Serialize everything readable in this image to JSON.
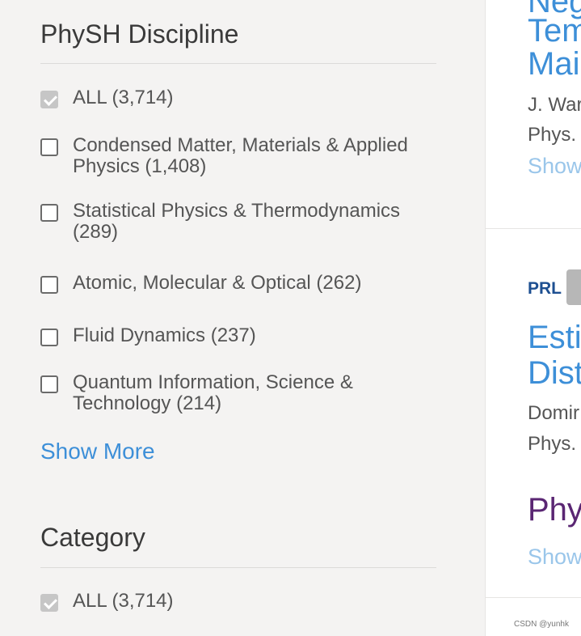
{
  "physh": {
    "title": "PhySH Discipline",
    "options": [
      {
        "label": "ALL (3,714)",
        "checked": true
      },
      {
        "label": "Condensed Matter, Materials & Applied Physics (1,408)",
        "checked": false
      },
      {
        "label": "Statistical Physics & Thermodynamics (289)",
        "checked": false
      },
      {
        "label": "Atomic, Molecular & Optical (262)",
        "checked": false
      },
      {
        "label": "Fluid Dynamics (237)",
        "checked": false
      },
      {
        "label": "Quantum Information, Science & Technology (214)",
        "checked": false
      }
    ],
    "show_more": "Show More"
  },
  "category": {
    "title": "Category",
    "options": [
      {
        "label": "ALL (3,714)",
        "checked": true
      }
    ]
  },
  "results": {
    "item1": {
      "title_lines": [
        "Neg",
        "Tem",
        "Mai"
      ],
      "authors": "J. War",
      "journal": "Phys.",
      "show": "Show"
    },
    "item2": {
      "journal_badge": "PRL",
      "title_lines": [
        "Esti",
        "Dist"
      ],
      "authors": "Domir",
      "journal": "Phys.",
      "brand": "Phys",
      "show": "Show"
    }
  },
  "watermark": "CSDN @yunhk"
}
